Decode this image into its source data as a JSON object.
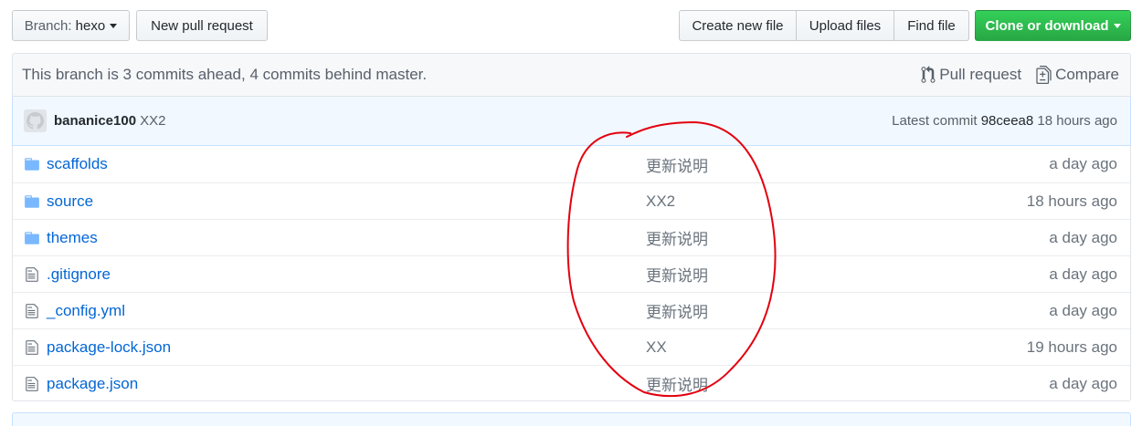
{
  "toolbar": {
    "branch_prefix": "Branch:",
    "branch_name": "hexo",
    "new_pull_request": "New pull request",
    "create_new_file": "Create new file",
    "upload_files": "Upload files",
    "find_file": "Find file",
    "clone_or_download": "Clone or download"
  },
  "branch_info": {
    "text": "This branch is 3 commits ahead, 4 commits behind master.",
    "pull_request": "Pull request",
    "compare": "Compare"
  },
  "latest_commit": {
    "author": "bananice100",
    "message": "XX2",
    "label": "Latest commit",
    "sha": "98ceea8",
    "age": "18 hours ago"
  },
  "files": [
    {
      "type": "folder",
      "name": "scaffolds",
      "message": "更新说明",
      "age": "a day ago"
    },
    {
      "type": "folder",
      "name": "source",
      "message": "XX2",
      "age": "18 hours ago"
    },
    {
      "type": "folder",
      "name": "themes",
      "message": "更新说明",
      "age": "a day ago"
    },
    {
      "type": "file",
      "name": ".gitignore",
      "message": "更新说明",
      "age": "a day ago"
    },
    {
      "type": "file",
      "name": "_config.yml",
      "message": "更新说明",
      "age": "a day ago"
    },
    {
      "type": "file",
      "name": "package-lock.json",
      "message": "XX",
      "age": "19 hours ago"
    },
    {
      "type": "file",
      "name": "package.json",
      "message": "更新说明",
      "age": "a day ago"
    }
  ],
  "colors": {
    "link": "#0366d6",
    "primary": "#28a745",
    "annotation": "#e3000f"
  },
  "icons": {
    "branch_caret": "caret-down-icon",
    "pull_request": "git-pull-request-icon",
    "compare": "diff-icon",
    "folder": "folder-icon",
    "file": "file-text-icon"
  }
}
